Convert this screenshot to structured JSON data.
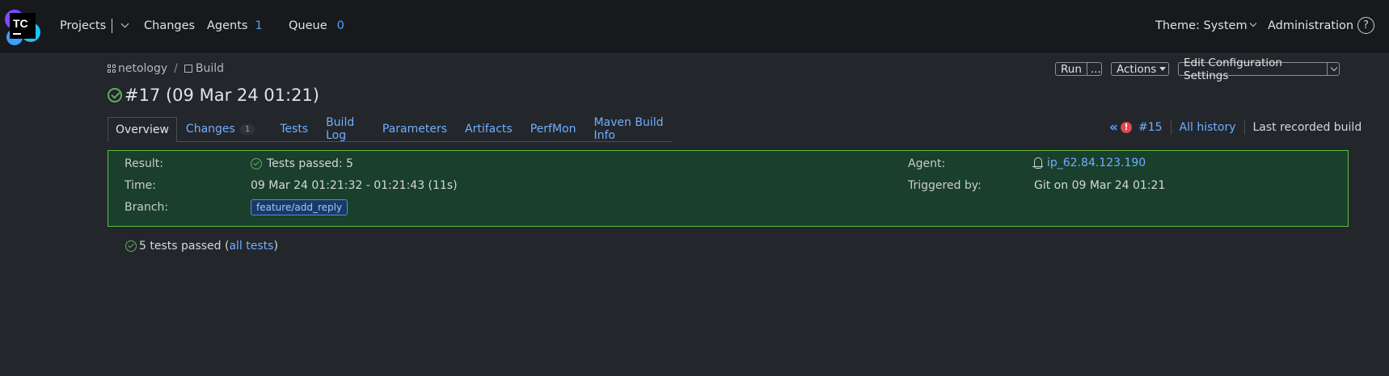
{
  "header": {
    "logo_text": "TC",
    "nav": {
      "projects": "Projects",
      "changes": "Changes",
      "agents": "Agents",
      "agents_count": "1",
      "queue": "Queue",
      "queue_count": "0"
    },
    "theme": "Theme: System",
    "administration": "Administration",
    "help": "?"
  },
  "breadcrumb": {
    "project": "netology",
    "separator": "/",
    "build_config": "Build"
  },
  "build_title": "#17 (09 Mar 24 01:21)",
  "actions": {
    "run": "Run",
    "run_more": "...",
    "actions": "Actions",
    "edit_settings": "Edit Configuration Settings"
  },
  "tabs": [
    {
      "label": "Overview",
      "active": true
    },
    {
      "label": "Changes",
      "badge": "1"
    },
    {
      "label": "Tests"
    },
    {
      "label": "Build Log"
    },
    {
      "label": "Parameters"
    },
    {
      "label": "Artifacts"
    },
    {
      "label": "PerfMon"
    },
    {
      "label": "Maven Build Info"
    }
  ],
  "history": {
    "prev_glyph": "«",
    "failed_build": "#15",
    "all_history": "All history",
    "last_recorded": "Last recorded build"
  },
  "details": {
    "result_label": "Result:",
    "result_value": "Tests passed: 5",
    "time_label": "Time:",
    "time_value": "09 Mar 24 01:21:32 - 01:21:43 (11s)",
    "branch_label": "Branch:",
    "branch_value": "feature/add_reply",
    "agent_label": "Agent:",
    "agent_value": "ip_62.84.123.190",
    "triggered_label": "Triggered by:",
    "triggered_value": "Git on 09 Mar 24 01:21"
  },
  "tests_summary": {
    "text": "5 tests passed (",
    "link": "all tests",
    "close": ")"
  },
  "colors": {
    "background": "#23262b",
    "topbar": "#17191c",
    "link": "#6fb0ff",
    "success": "#5fb05f",
    "panel_border": "#5fbf3f",
    "panel_bg": "#1a3f2c",
    "error": "#e0474c"
  }
}
